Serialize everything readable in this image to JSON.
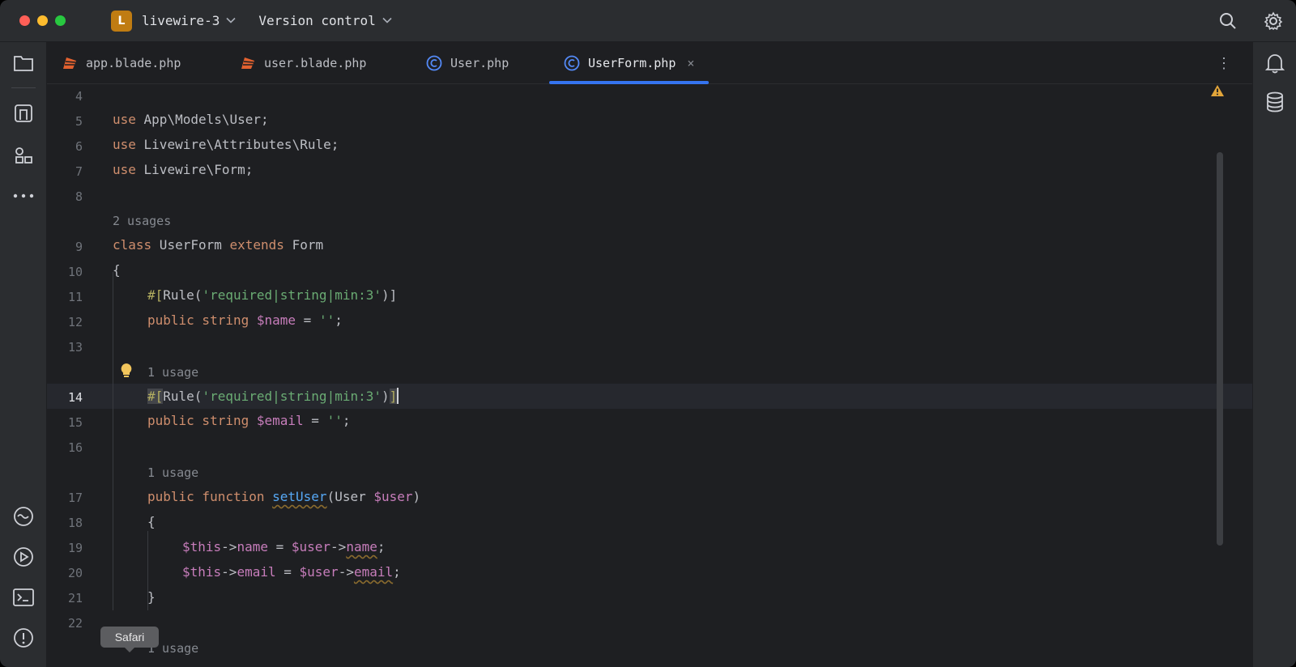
{
  "titlebar": {
    "project_initial": "L",
    "project_name": "livewire-3",
    "vcs_label": "Version control"
  },
  "tabs": [
    {
      "label": "app.blade.php",
      "icon": "blade-icon",
      "active": false
    },
    {
      "label": "user.blade.php",
      "icon": "blade-icon",
      "active": false
    },
    {
      "label": "User.php",
      "icon": "php-class-icon",
      "active": false
    },
    {
      "label": "UserForm.php",
      "icon": "php-class-icon",
      "active": true
    }
  ],
  "tab_close_glyph": "×",
  "tabs_more_glyph": "⋮",
  "editor": {
    "gutter": [
      "4",
      "5",
      "6",
      "7",
      "8",
      "9",
      "10",
      "11",
      "12",
      "13",
      "14",
      "15",
      "16",
      "17",
      "18",
      "19",
      "20",
      "21",
      "22"
    ],
    "current_line": "14",
    "hints": {
      "class_usages": "2 usages",
      "email_usages": "1 usage",
      "setuser_usages": "1 usage",
      "bottom_usages": "1 usage"
    },
    "lines": {
      "l5_kw": "use",
      "l5_rest": " App\\Models\\User;",
      "l6_kw": "use",
      "l6_rest": " Livewire\\Attributes\\Rule;",
      "l7_kw": "use",
      "l7_rest": " Livewire\\Form;",
      "l9_class": "class",
      "l9_name": " UserForm ",
      "l9_extends": "extends",
      "l9_base": " Form",
      "l10": "{",
      "l11_hash": "#[",
      "l11_rule": "Rule",
      "l11_open": "(",
      "l11_str": "'required|string|min:3'",
      "l11_close": ")]",
      "l12_public": "public",
      "l12_type": " string ",
      "l12_var": "$name",
      "l12_eq": " = ",
      "l12_str": "''",
      "l12_end": ";",
      "l14_hash": "#[",
      "l14_rule": "Rule",
      "l14_open": "(",
      "l14_str": "'required|string|min:3'",
      "l14_paren": ")",
      "l14_bracket": "]",
      "l15_public": "public",
      "l15_type": " string ",
      "l15_var": "$email",
      "l15_eq": " = ",
      "l15_str": "''",
      "l15_end": ";",
      "l17_public": "public",
      "l17_function": " function ",
      "l17_name": "setUser",
      "l17_open": "(User ",
      "l17_var": "$user",
      "l17_close": ")",
      "l18": "{",
      "l19_this": "$this",
      "l19_arrow": "->",
      "l19_prop": "name",
      "l19_eq": " = ",
      "l19_user": "$user",
      "l19_arrow2": "->",
      "l19_prop2": "name",
      "l19_end": ";",
      "l20_this": "$this",
      "l20_arrow": "->",
      "l20_prop": "email",
      "l20_eq": " = ",
      "l20_user": "$user",
      "l20_arrow2": "->",
      "l20_prop2": "email",
      "l20_end": ";",
      "l21": "}"
    }
  },
  "tooltip": "Safari",
  "colors": {
    "accent": "#3574f0",
    "project_badge": "#c07c12",
    "warning": "#e2a53a",
    "bulb": "#f2c55c"
  },
  "icons": {
    "left_strip": [
      "folder-icon",
      "commit-icon",
      "structure-icon",
      "more-icon",
      "services-icon",
      "run-icon",
      "terminal-icon",
      "problems-icon"
    ],
    "right_strip": [
      "notifications-icon",
      "database-icon"
    ],
    "titlebar": [
      "search-icon",
      "gear-icon"
    ]
  }
}
